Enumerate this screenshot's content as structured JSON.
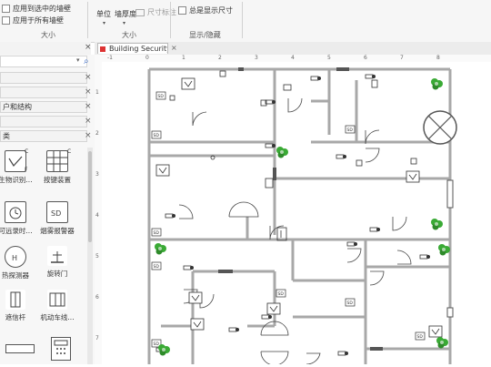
{
  "ribbon": {
    "wall_selected": "应用到选中的墙壁",
    "wall_all": "应用于所有墙壁",
    "group_size_left": "大小",
    "unit_label": "单位",
    "wall_thickness": "墙厚度",
    "dim_label": "尺寸标注",
    "group_size_mid": "大小",
    "always_show_dim": "总是显示尺寸",
    "group_show_hide": "显示/隐藏"
  },
  "library": {
    "rows": [
      "",
      "户和结构",
      "",
      "类"
    ],
    "shapes": [
      {
        "label": "生物识别..."
      },
      {
        "label": "按键装置"
      },
      {
        "label": "可远录时..."
      },
      {
        "label": "烟雾报警器"
      },
      {
        "label": "热探测器"
      },
      {
        "label": "旋转门"
      },
      {
        "label": "遮信杆"
      },
      {
        "label": "机动车线..."
      }
    ]
  },
  "document": {
    "tab_title": "Building Security ..."
  },
  "ruler": {
    "h": [
      "-1",
      "0",
      "1",
      "2",
      "3",
      "4",
      "5",
      "6",
      "7",
      "8"
    ],
    "v": [
      "1",
      "2",
      "3",
      "4",
      "5",
      "6",
      "7"
    ]
  },
  "floorplan": {
    "sd_label": "SD",
    "colors": {
      "wall": "#a8a8a8",
      "device": "#333333",
      "green": "#3aaa35"
    }
  }
}
